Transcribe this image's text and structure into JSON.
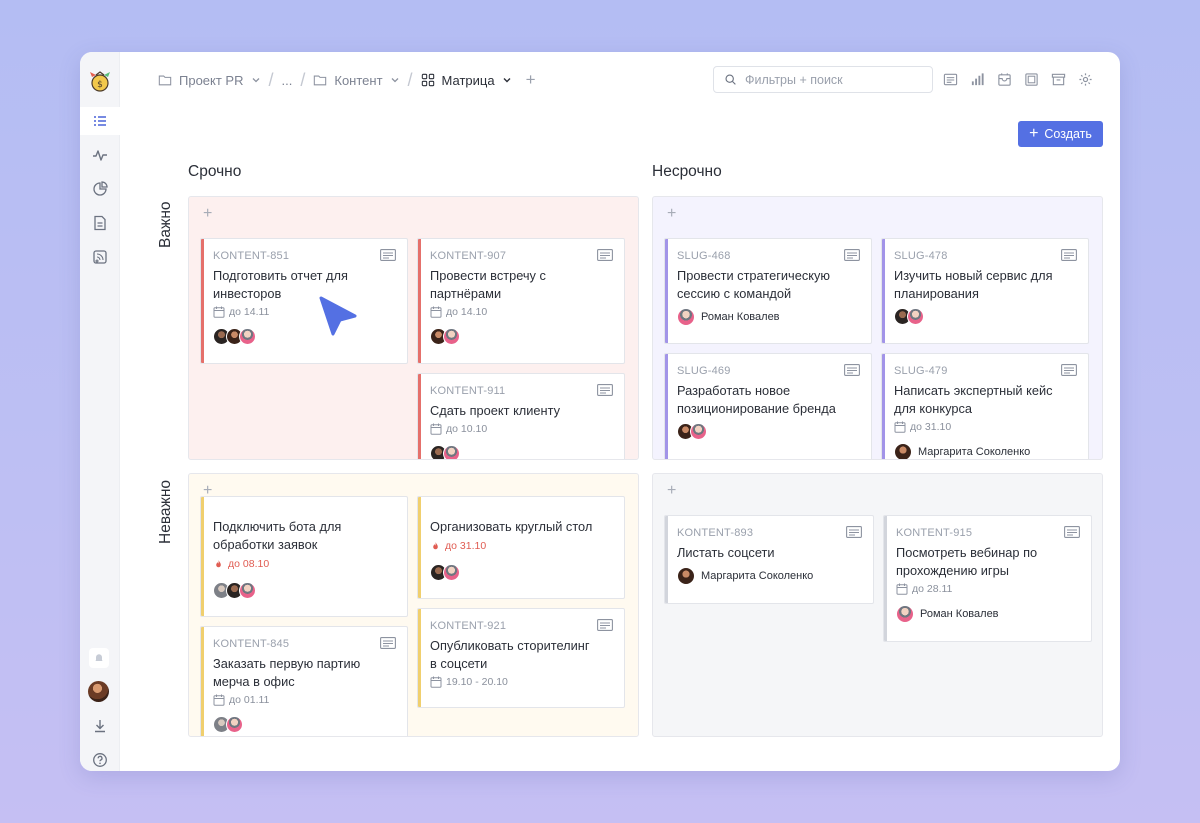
{
  "breadcrumbs": {
    "project": "Проект PR",
    "ellipsis": "...",
    "folder": "Контент",
    "view": "Матрица"
  },
  "search": {
    "placeholder": "Фильтры + поиск"
  },
  "create_button": {
    "label": "Создать"
  },
  "columns": {
    "urgent": "Срочно",
    "not_urgent": "Несрочно"
  },
  "rows": {
    "important": "Важно",
    "not_important": "Неважно"
  },
  "colors": {
    "accent": "#5470e3",
    "urgent_important_bg": "#fdf0ef",
    "urgent_important_accent": "#e5706b",
    "not_urgent_important_bg": "#f4f3fe",
    "not_urgent_important_accent": "#a294e8",
    "urgent_not_important_bg": "#fffaf0",
    "urgent_not_important_accent": "#f0cf6e",
    "not_urgent_not_important_bg": "#f5f6f8",
    "not_urgent_not_important_accent": "#d2d5dc"
  },
  "cards": {
    "k851": {
      "id": "KONTENT-851",
      "title_1": "Подготовить отчет для",
      "title_2": "инвесторов",
      "date": "до 14.11"
    },
    "k907": {
      "id": "KONTENT-907",
      "title_1": "Провести встречу с",
      "title_2": "партнёрами",
      "date": "до 14.10"
    },
    "k911": {
      "id": "KONTENT-911",
      "title_1": "Сдать проект клиенту",
      "date": "до 10.10"
    },
    "s468": {
      "id": "SLUG-468",
      "title_1": "Провести стратегическую",
      "title_2": "сессию с командой",
      "person": "Роман Ковалев"
    },
    "s478": {
      "id": "SLUG-478",
      "title_1": "Изучить новый сервис для",
      "title_2": "планирования"
    },
    "s469": {
      "id": "SLUG-469",
      "title_1": "Разработать новое",
      "title_2": "позиционирование бренда"
    },
    "s479": {
      "id": "SLUG-479",
      "title_1": "Написать экспертный кейс",
      "title_2": "для конкурса",
      "date": "до 31.10",
      "person": "Маргарита Соколенко"
    },
    "bot": {
      "title_1": "Подключить бота для",
      "title_2": "обработки заявок",
      "date": "до 08.10"
    },
    "round": {
      "title_1": "Организовать круглый стол",
      "date": "до 31.10"
    },
    "k845": {
      "id": "KONTENT-845",
      "title_1": "Заказать первую партию",
      "title_2": "мерча в офис",
      "date": "до 01.11"
    },
    "k921": {
      "id": "KONTENT-921",
      "title_1": "Опубликовать сторителинг",
      "title_2": "в соцсети",
      "date": "19.10 - 20.10"
    },
    "k893": {
      "id": "KONTENT-893",
      "title_1": "Листать соцсети",
      "person": "Маргарита Соколенко"
    },
    "k915": {
      "id": "KONTENT-915",
      "title_1": "Посмотреть вебинар по",
      "title_2": "прохождению игры",
      "date": "до 28.11",
      "person": "Роман Ковалев"
    }
  },
  "icons": {
    "sidebar": [
      "list-icon",
      "activity-icon",
      "pie-chart-icon",
      "document-icon",
      "feed-icon",
      "bell-icon",
      "download-icon",
      "help-icon"
    ],
    "toolbar": [
      "card-view-icon",
      "bar-chart-icon",
      "inbox-icon",
      "calendar-icon",
      "archive-icon",
      "settings-icon"
    ]
  }
}
